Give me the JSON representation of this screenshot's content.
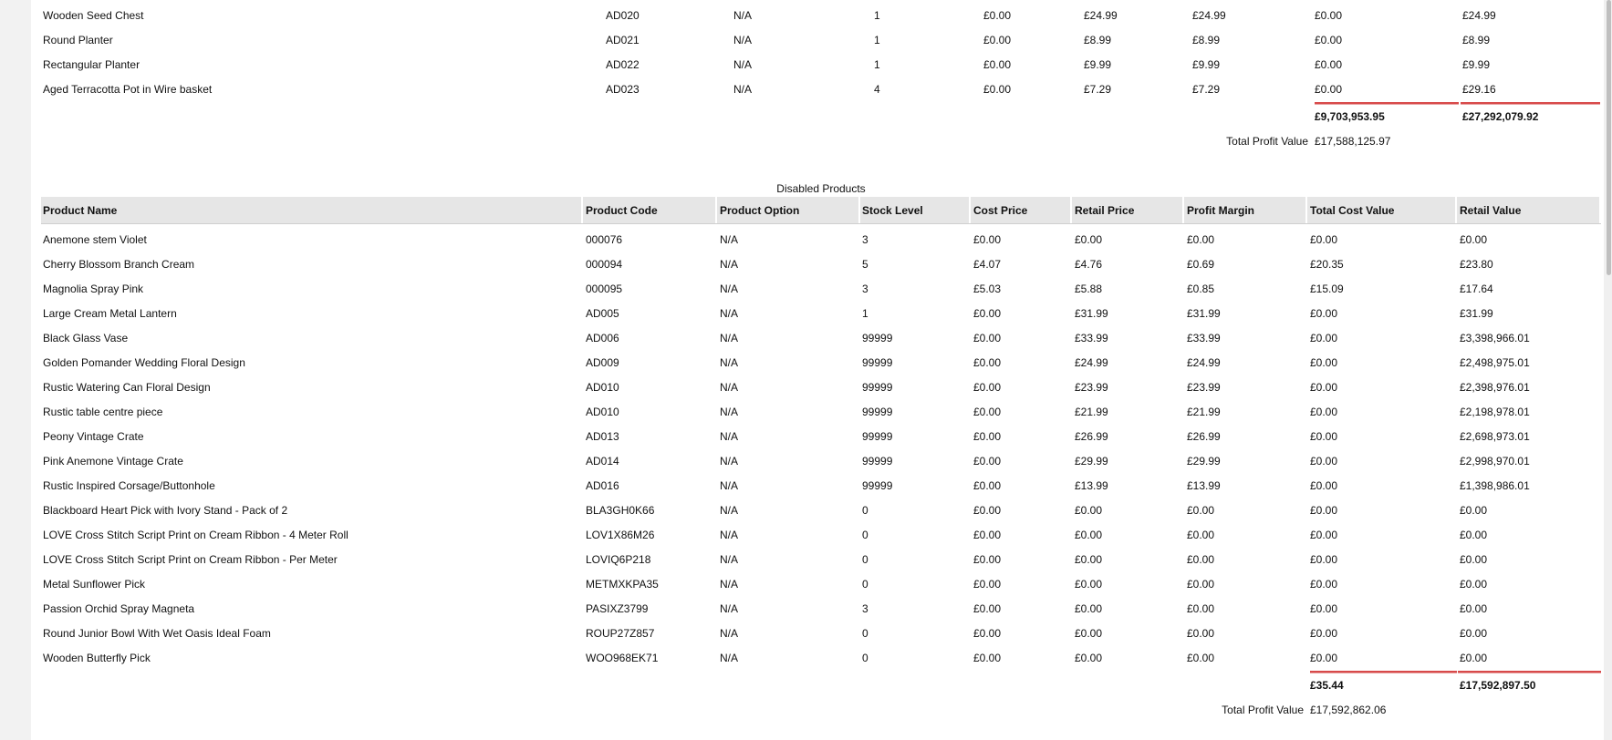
{
  "enabled_table": {
    "rows": [
      [
        "Wooden Seed Chest",
        "AD020",
        "N/A",
        "1",
        "£0.00",
        "£24.99",
        "£24.99",
        "£0.00",
        "£24.99"
      ],
      [
        "Round Planter",
        "AD021",
        "N/A",
        "1",
        "£0.00",
        "£8.99",
        "£8.99",
        "£0.00",
        "£8.99"
      ],
      [
        "Rectangular Planter",
        "AD022",
        "N/A",
        "1",
        "£0.00",
        "£9.99",
        "£9.99",
        "£0.00",
        "£9.99"
      ],
      [
        "Aged Terracotta Pot in Wire basket",
        "AD023",
        "N/A",
        "4",
        "£0.00",
        "£7.29",
        "£7.29",
        "£0.00",
        "£29.16"
      ]
    ],
    "total_cost_value": "£9,703,953.95",
    "total_retail_value": "£27,292,079.92",
    "total_profit_label": "Total Profit Value",
    "total_profit_value": "£17,588,125.97"
  },
  "disabled_table": {
    "title": "Disabled Products",
    "headers": [
      "Product Name",
      "Product Code",
      "Product Option",
      "Stock Level",
      "Cost Price",
      "Retail Price",
      "Profit Margin",
      "Total Cost Value",
      "Retail Value"
    ],
    "rows": [
      [
        "Anemone stem Violet",
        "000076",
        "N/A",
        "3",
        "£0.00",
        "£0.00",
        "£0.00",
        "£0.00",
        "£0.00"
      ],
      [
        "Cherry Blossom Branch Cream",
        "000094",
        "N/A",
        "5",
        "£4.07",
        "£4.76",
        "£0.69",
        "£20.35",
        "£23.80"
      ],
      [
        "Magnolia Spray Pink",
        "000095",
        "N/A",
        "3",
        "£5.03",
        "£5.88",
        "£0.85",
        "£15.09",
        "£17.64"
      ],
      [
        "Large Cream Metal Lantern",
        "AD005",
        "N/A",
        "1",
        "£0.00",
        "£31.99",
        "£31.99",
        "£0.00",
        "£31.99"
      ],
      [
        "Black Glass Vase",
        "AD006",
        "N/A",
        "99999",
        "£0.00",
        "£33.99",
        "£33.99",
        "£0.00",
        "£3,398,966.01"
      ],
      [
        "Golden Pomander Wedding Floral Design",
        "AD009",
        "N/A",
        "99999",
        "£0.00",
        "£24.99",
        "£24.99",
        "£0.00",
        "£2,498,975.01"
      ],
      [
        "Rustic Watering Can Floral Design",
        "AD010",
        "N/A",
        "99999",
        "£0.00",
        "£23.99",
        "£23.99",
        "£0.00",
        "£2,398,976.01"
      ],
      [
        "Rustic table centre piece",
        "AD010",
        "N/A",
        "99999",
        "£0.00",
        "£21.99",
        "£21.99",
        "£0.00",
        "£2,198,978.01"
      ],
      [
        "Peony Vintage Crate",
        "AD013",
        "N/A",
        "99999",
        "£0.00",
        "£26.99",
        "£26.99",
        "£0.00",
        "£2,698,973.01"
      ],
      [
        "Pink Anemone Vintage Crate",
        "AD014",
        "N/A",
        "99999",
        "£0.00",
        "£29.99",
        "£29.99",
        "£0.00",
        "£2,998,970.01"
      ],
      [
        "Rustic Inspired Corsage/Buttonhole",
        "AD016",
        "N/A",
        "99999",
        "£0.00",
        "£13.99",
        "£13.99",
        "£0.00",
        "£1,398,986.01"
      ],
      [
        "Blackboard Heart Pick with Ivory Stand - Pack of 2",
        "BLA3GH0K66",
        "N/A",
        "0",
        "£0.00",
        "£0.00",
        "£0.00",
        "£0.00",
        "£0.00"
      ],
      [
        "LOVE Cross Stitch Script Print on Cream Ribbon - 4 Meter Roll",
        "LOV1X86M26",
        "N/A",
        "0",
        "£0.00",
        "£0.00",
        "£0.00",
        "£0.00",
        "£0.00"
      ],
      [
        "LOVE Cross Stitch Script Print on Cream Ribbon - Per Meter",
        "LOVIQ6P218",
        "N/A",
        "0",
        "£0.00",
        "£0.00",
        "£0.00",
        "£0.00",
        "£0.00"
      ],
      [
        "Metal Sunflower Pick",
        "METMXKPA35",
        "N/A",
        "0",
        "£0.00",
        "£0.00",
        "£0.00",
        "£0.00",
        "£0.00"
      ],
      [
        "Passion Orchid Spray Magneta",
        "PASIXZ3799",
        "N/A",
        "3",
        "£0.00",
        "£0.00",
        "£0.00",
        "£0.00",
        "£0.00"
      ],
      [
        "Round Junior Bowl With Wet Oasis Ideal Foam",
        "ROUP27Z857",
        "N/A",
        "0",
        "£0.00",
        "£0.00",
        "£0.00",
        "£0.00",
        "£0.00"
      ],
      [
        "Wooden Butterfly Pick",
        "WOO968EK71",
        "N/A",
        "0",
        "£0.00",
        "£0.00",
        "£0.00",
        "£0.00",
        "£0.00"
      ]
    ],
    "total_cost_value": "£35.44",
    "total_retail_value": "£17,592,897.50",
    "total_profit_label": "Total Profit Value",
    "total_profit_value": "£17,592,862.06"
  },
  "colors": {
    "header_bg": "#e6e6e6",
    "total_underline": "#d84a4a"
  }
}
